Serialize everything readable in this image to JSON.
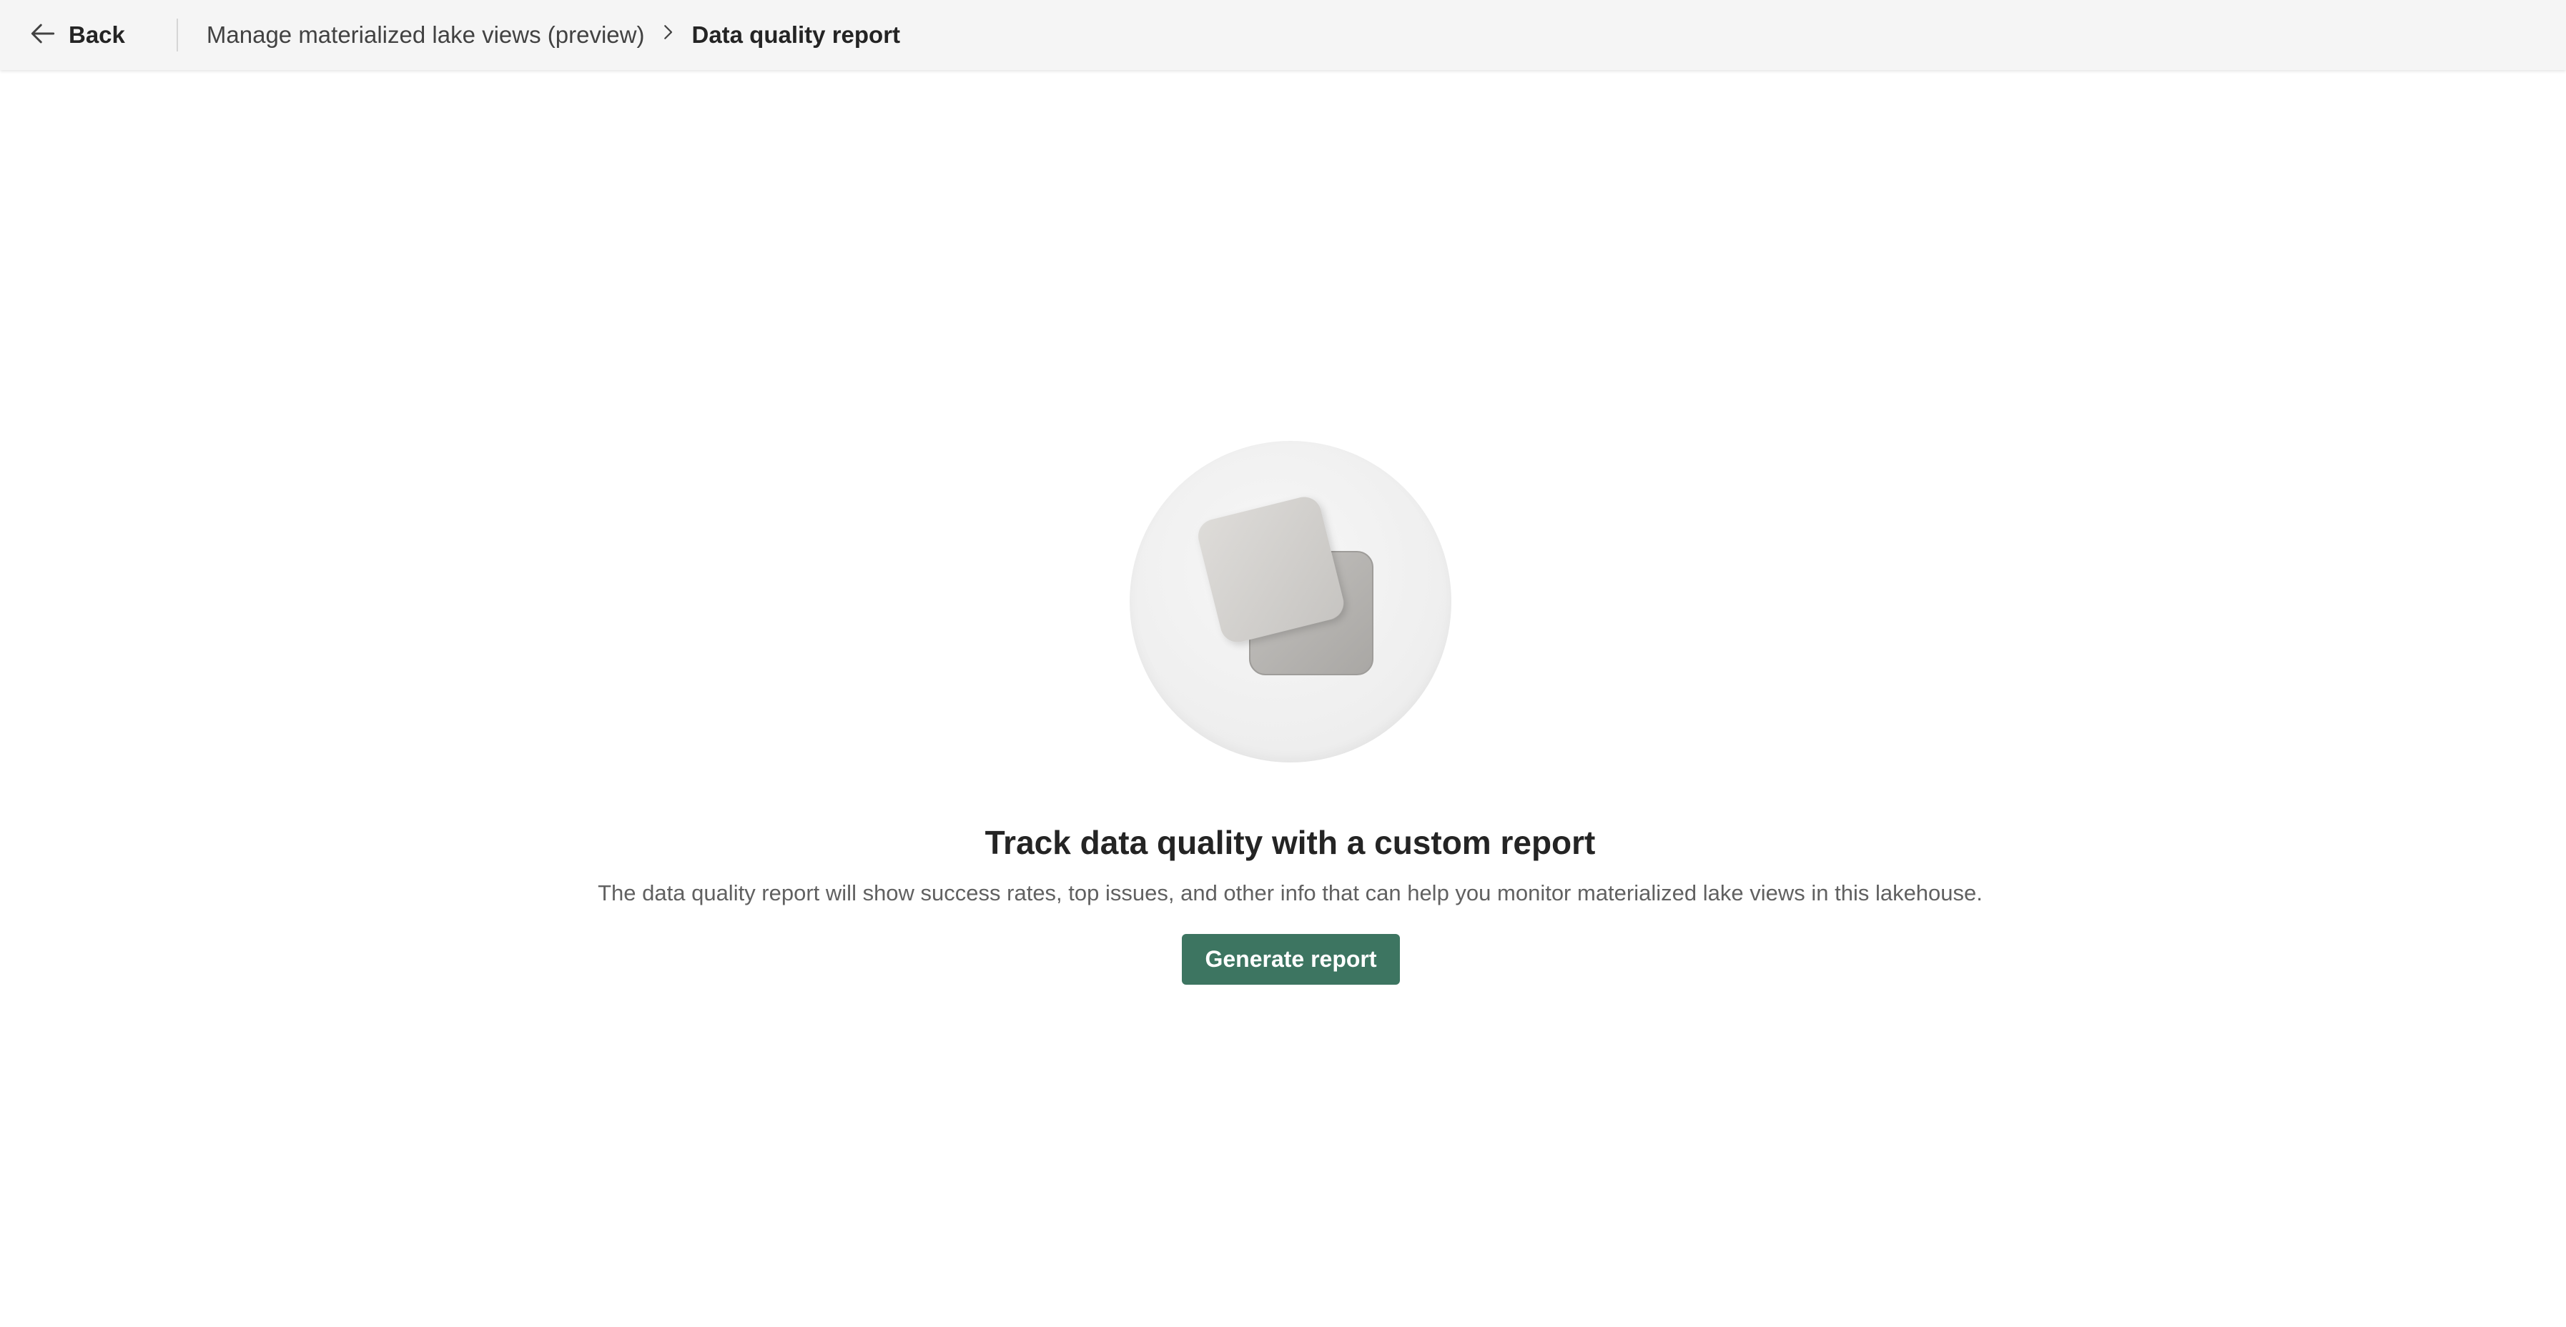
{
  "header": {
    "back_label": "Back",
    "breadcrumb": [
      {
        "label": "Manage materialized lake views (preview)"
      },
      {
        "label": "Data quality report"
      }
    ]
  },
  "empty_state": {
    "illustration": "stacked-squares-illustration",
    "title": "Track data quality with a custom report",
    "description": "The data quality report will show success rates, top issues, and other info that can help you monitor materialized lake views in this lakehouse.",
    "action_label": "Generate report"
  },
  "colors": {
    "primary_button": "#3d7561",
    "topbar_background": "#f5f5f5"
  }
}
